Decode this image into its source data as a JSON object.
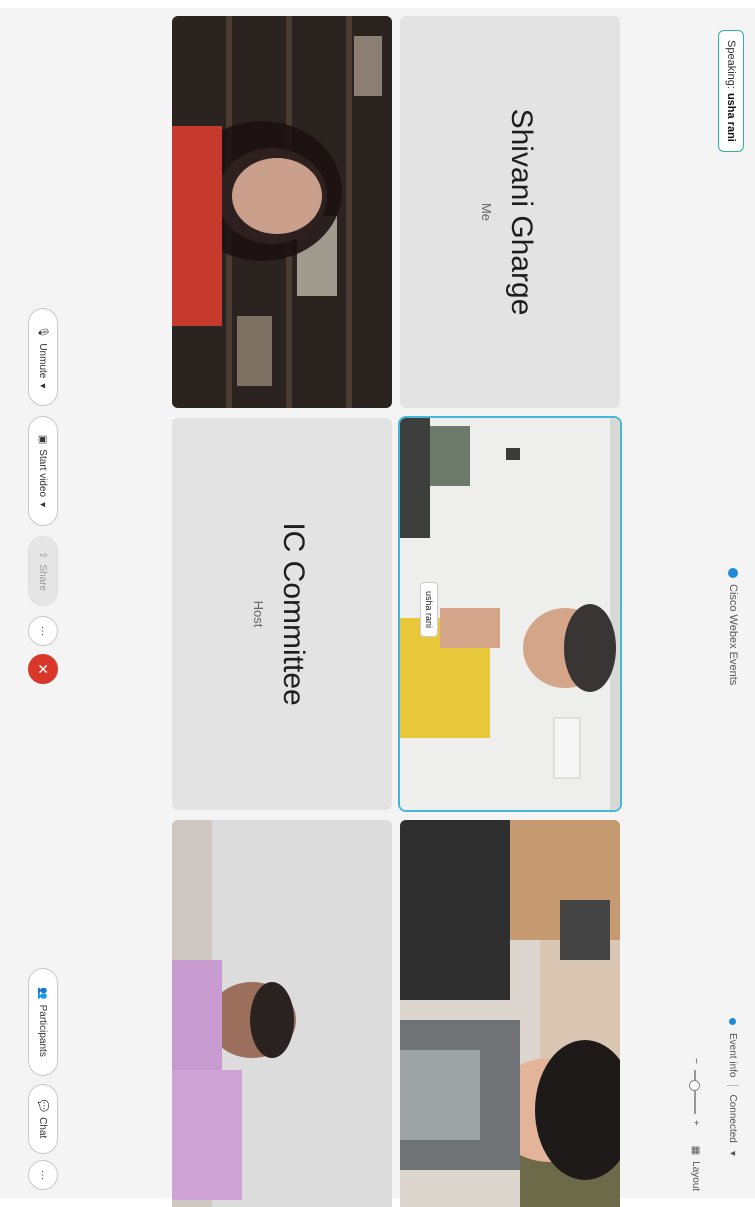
{
  "speaking": {
    "label": "Speaking:",
    "name": "usha rani"
  },
  "meeting_title": "Cisco Webex Events",
  "top_right": {
    "event_info": "Event info",
    "connected": "Connected"
  },
  "layout_label": "Layout",
  "zoom": {
    "minus": "−",
    "plus": "+"
  },
  "tiles": [
    {
      "name": "Shivani Gharge",
      "subtitle": "Me",
      "type": "placeholder"
    },
    {
      "name": "usha rani",
      "type": "video",
      "active": true
    },
    {
      "type": "video"
    },
    {
      "type": "video"
    },
    {
      "name": "IC Committee",
      "subtitle": "Host",
      "type": "placeholder"
    },
    {
      "type": "video"
    }
  ],
  "controls": {
    "unmute": "Unmute",
    "start_video": "Start video",
    "share": "Share",
    "more": "···",
    "leave": "✕",
    "participants": "Participants",
    "chat": "Chat",
    "overflow": "···"
  },
  "colors": {
    "accent": "#46b7d6",
    "leave": "#d9372b",
    "speaking_border": "#2bb5a0"
  }
}
